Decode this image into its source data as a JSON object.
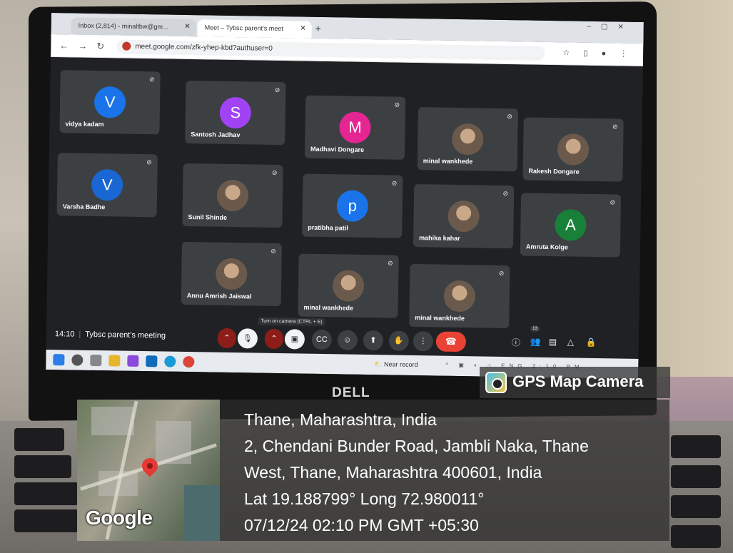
{
  "browser": {
    "tab1_title": "Inbox (2,814) - minaltbw@gm...",
    "tab2_title": "Meet – Tybsc parent's meet",
    "url": "meet.google.com/zfk-yhep-kbd?authuser=0"
  },
  "meet": {
    "participants": [
      {
        "name": "vidya kadam",
        "initial": "V",
        "color": "#1a73e8"
      },
      {
        "name": "Santosh Jadhav",
        "initial": "S",
        "color": "#a142f4"
      },
      {
        "name": "Madhavi Dongare",
        "initial": "M",
        "color": "#e52592"
      },
      {
        "name": "minal wankhede",
        "initial": ""
      },
      {
        "name": "Rakesh Dongare",
        "initial": ""
      },
      {
        "name": "Varsha Badhe",
        "initial": "V",
        "color": "#1967d2"
      },
      {
        "name": "Sunil Shinde",
        "initial": ""
      },
      {
        "name": "pratibha patil",
        "initial": "p",
        "color": "#1a73e8"
      },
      {
        "name": "mahika kahar",
        "initial": ""
      },
      {
        "name": "Amruta Kolge",
        "initial": "A",
        "color": "#188038"
      },
      {
        "name": "Annu Amrish Jaiswal",
        "initial": ""
      },
      {
        "name": "minal wankhede",
        "initial": ""
      },
      {
        "name": "minal wankhede",
        "initial": ""
      }
    ],
    "time": "14:10",
    "meeting_title": "Tybsc parent's meeting",
    "tooltip": "Turn on camera (CTRL + E)",
    "participant_count": "13"
  },
  "taskbar": {
    "near_record": "Near record",
    "tray_lang": "ENG",
    "tray_time": "2:10 PM"
  },
  "laptop_brand": "DELL",
  "stamp": {
    "app_name": "GPS Map Camera",
    "map_label": "Google",
    "city_line": "Thane, Maharashtra, India",
    "address_line1": "2, Chendani Bunder Road, Jambli Naka, Thane",
    "address_line2": "West, Thane, Maharashtra 400601, India",
    "latlong": "Lat 19.188799° Long 72.980011°",
    "datetime": "07/12/24 02:10 PM GMT +05:30"
  }
}
